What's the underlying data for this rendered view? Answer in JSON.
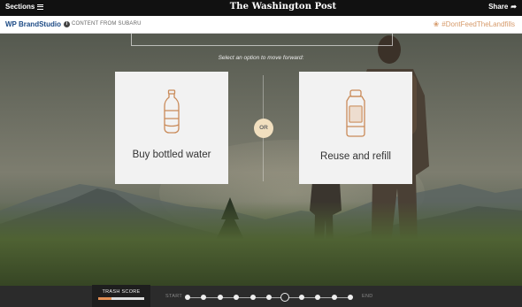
{
  "topbar": {
    "sections_label": "Sections",
    "logo_text": "The Washington Post",
    "share_label": "Share"
  },
  "brandbar": {
    "brand_label": "WP BrandStudio",
    "content_from": "CONTENT FROM SUBARU",
    "hashtag": "#DontFeedTheLandfills"
  },
  "main": {
    "instruction": "Select an option to move forward:",
    "options": [
      {
        "label": "Buy bottled water",
        "icon": "plastic-bottle-icon"
      },
      {
        "label": "Reuse and refill",
        "icon": "refillable-bottle-icon"
      }
    ],
    "or_label": "OR"
  },
  "progress": {
    "trash_score_label": "TRASH SCORE",
    "trash_score_fraction": 0.28,
    "start_label": "START",
    "end_label": "END",
    "total_steps": 11,
    "current_step": 7
  },
  "colors": {
    "accent": "#d69a6a",
    "brand_blue": "#1c4a85",
    "icon_stroke": "#c98a58",
    "or_badge": "#f1dfbf",
    "trash_fill": "#e38f55"
  }
}
